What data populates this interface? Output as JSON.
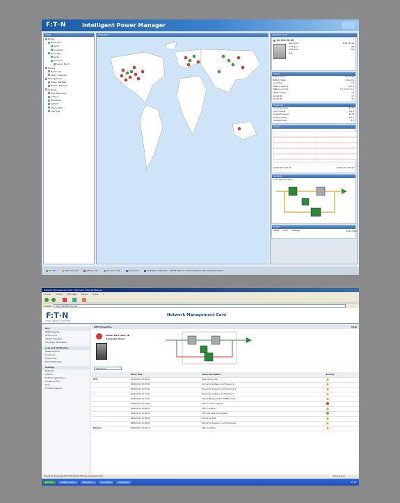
{
  "ipm": {
    "logo": "F:T·N",
    "title": "Intelligent Power Manager",
    "nav_title": "Views",
    "map_title": "Node Map",
    "details_title": "Selection View",
    "tree": [
      "Nodes",
      "Node List",
      "Grids",
      "Dynamic",
      "Node Map",
      "Grids",
      "Dynamic",
      "Server Room",
      "Events",
      "Event List",
      "Event Calendar",
      "Management",
      "Views Settings",
      "Nodes Upgrade",
      "Settings",
      "Auto Discovery",
      "Actions",
      "Shutdown",
      "System",
      "Shared Info",
      "User List"
    ],
    "node_ip": "10.130.56.65",
    "info": [
      [
        "Description",
        "9155 15 kVA"
      ],
      [
        "Host Type",
        "UPS"
      ],
      [
        "Host Mode",
        "Ups"
      ],
      [
        "Link",
        ""
      ]
    ],
    "status_title": "Status",
    "status": [
      [
        "Power Source",
        "On utility"
      ],
      [
        "Battery State",
        "Charging"
      ],
      [
        "Load level",
        "5 %"
      ],
      [
        "Battery capacity",
        "100 %"
      ],
      [
        "Battery run time",
        "3 h 42 min 31 s"
      ],
      [
        "Master output",
        "On"
      ],
      [
        "Outlet #1",
        "On"
      ],
      [
        "Outlet #2",
        "On"
      ]
    ],
    "measures_title": "Measures",
    "measures": [
      [
        "Input Frequency",
        "50 Hz"
      ],
      [
        "Input voltage",
        "119 V"
      ],
      [
        "Output Frequency",
        "49 Hz"
      ],
      [
        "Output voltage",
        "119 V"
      ],
      [
        "Output current",
        "5 A"
      ]
    ],
    "graph_title": "Graph",
    "graph_from": "2009/11/23 14:53:27",
    "graph_to": "2009/11/24 14:53:27",
    "synoptic_title": "Synoptic",
    "synoptic_sub": "Line Interactive UPS",
    "synoptic_out": "Power output",
    "events_title": "Events",
    "events_cols": [
      "Status",
      "Date",
      "Message"
    ],
    "statusbar": [
      "OK: 367",
      "Warning: 240",
      "Critical: 342",
      "Unknown: 247",
      "Last event",
      "11/23/09 2:14:45 pm - 166.99.129.45 - Communication with device has failed"
    ]
  },
  "nmc": {
    "window_title": "Network Management Card - Microsoft Internet Explorer",
    "menu": [
      "Fichier",
      "Edition",
      "Affichage",
      "Favoris",
      "Outils",
      "?"
    ],
    "address_label": "Adresse",
    "address": "http://166.99.224.155",
    "logo": "F:T·N",
    "logo_sub": "Powering Business Worldwide",
    "page_title": "Network Management Card",
    "help": "Help",
    "nav_sections": [
      {
        "title": "UPS",
        "items": [
          "UPS Properties",
          "UPS Control",
          "Weekly Schedule",
          "Shutdown Parameters"
        ]
      },
      {
        "title": "Logs and Notification",
        "items": [
          "Measurements",
          "Event Log",
          "System Log",
          "Email Notification"
        ]
      },
      {
        "title": "Settings",
        "items": [
          "Network",
          "System",
          "Notified Applications",
          "Access Control",
          "Time",
          "Firmware Upload"
        ]
      }
    ],
    "props_title": "UPS Properties",
    "ups_name": "Pulsar MX Frame 5K",
    "ups_loc": "Computer Room",
    "filter": "UPS Alarms",
    "cols": [
      "",
      "Alarm Time",
      "Alarm Description",
      "Severity"
    ],
    "rows": [
      [
        "UPS",
        "1970/01/01 00:00:00",
        "Redundancy Lost",
        "warn"
      ],
      [
        "",
        "2009/10/14 13:07:00",
        "Normal AC voltage out of tolerance",
        "warn"
      ],
      [
        "",
        "2009/10/14 13:07:00",
        "Bypass AC frequency out of tolerance",
        "warn"
      ],
      [
        "",
        "2009/10/14 13:07:00",
        "Bypass AC voltage out of tolerance",
        "warn"
      ],
      [
        "",
        "2009/10/14 13:07:00",
        "Manual Bypass switch (Q3BP) closed",
        "warn"
      ],
      [
        "",
        "2009/10/14 13:07:00",
        "UPS on internal bypass",
        "alarm"
      ],
      [
        "",
        "2009/10/14 13:08:14",
        "UPS on battery",
        "warn"
      ],
      [
        "",
        "2009/10/14 13:08:24",
        "UPS data base not available",
        "ok"
      ],
      [
        "",
        "2009/10/14 13:09:45",
        "Normal AC NOK",
        "warn"
      ],
      [
        "",
        "2009/10/14 13:09:45",
        "Normal AC frequency out of tolerance",
        "warn"
      ],
      [
        "Module 1",
        "2009/10/14 13:09:13",
        "UPS on battery",
        "warn"
      ]
    ],
    "statusbar": "Ouverture de la page http://166.99.224.155/ups_propalarms.htm...",
    "zone": "Intranet local",
    "taskbar": [
      "Démarrer",
      "Network Mana...",
      "Boîte de ré...",
      "Document1",
      "Powerpoint"
    ],
    "clock": "11:48"
  },
  "colors": {
    "eaton_blue": "#1b5aa3",
    "panel_blue": "#3b6fb0",
    "nmc_title": "#1a4f9c",
    "ocean": "#cfe4f6",
    "land": "#ffffff",
    "grid_red": "#e05050"
  }
}
